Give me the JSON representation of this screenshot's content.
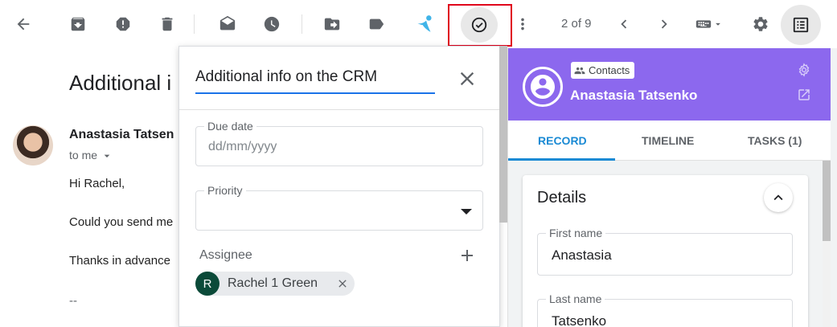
{
  "toolbar": {
    "icons": [
      "back-arrow-icon",
      "archive-icon",
      "report-spam-icon",
      "delete-icon",
      "mark-unread-icon",
      "snooze-icon",
      "move-to-icon",
      "label-icon",
      "crm-extension-icon",
      "add-task-icon",
      "more-vert-icon"
    ],
    "pager": "2 of 9",
    "highlight_color": "#e0001b"
  },
  "email": {
    "subject": "Additional i",
    "sender": "Anastasia Tatsen",
    "to": "to me",
    "lines": [
      "Hi Rachel,",
      "Could you send me",
      "Thanks in advance",
      "--"
    ]
  },
  "task_popup": {
    "title": "Additional info on the CRM",
    "due_date_label": "Due date",
    "due_date_placeholder": "dd/mm/yyyy",
    "priority_label": "Priority",
    "assignee_label": "Assignee",
    "assignee_initial": "R",
    "assignee_name": "Rachel 1 Green"
  },
  "panel": {
    "badge": "Contacts",
    "contact_name": "Anastasia Tatsenko",
    "header_color": "#8c68ee",
    "tabs": [
      "RECORD",
      "TIMELINE",
      "TASKS (1)"
    ],
    "active_tab": "RECORD",
    "details_title": "Details",
    "fields": [
      {
        "label": "First name",
        "value": "Anastasia"
      },
      {
        "label": "Last name",
        "value": "Tatsenko"
      }
    ]
  }
}
